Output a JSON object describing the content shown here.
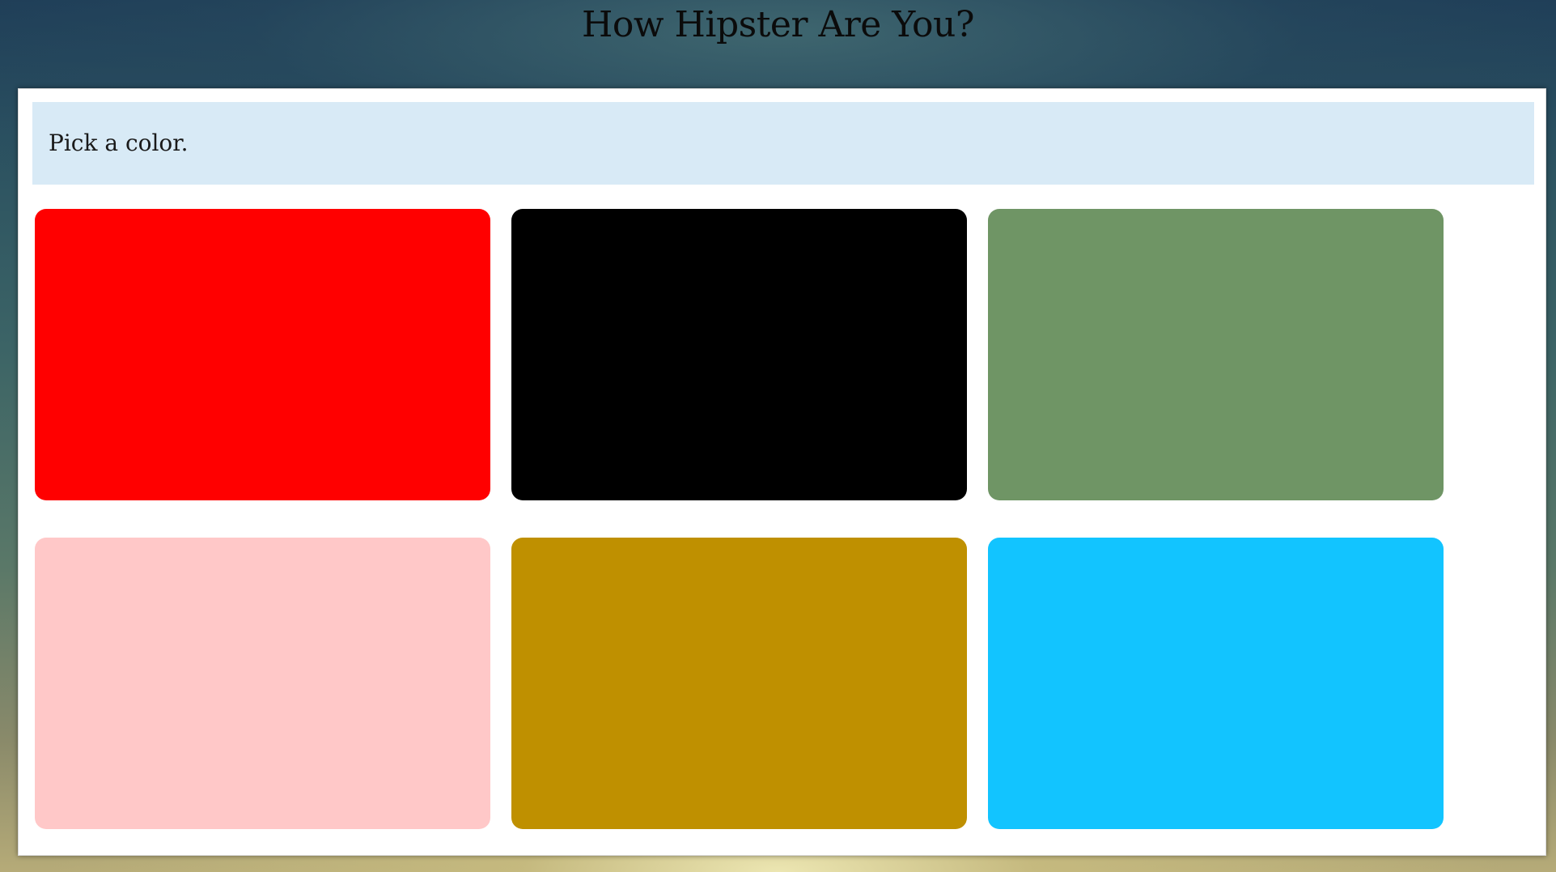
{
  "page": {
    "title": "How Hipster Are You?"
  },
  "question": {
    "text": "Pick a color."
  },
  "options": [
    {
      "name": "red",
      "color": "#ff0000"
    },
    {
      "name": "black",
      "color": "#000000"
    },
    {
      "name": "green",
      "color": "#6f9565"
    },
    {
      "name": "pink",
      "color": "#ffc8c8"
    },
    {
      "name": "mustard",
      "color": "#bf9000"
    },
    {
      "name": "sky-blue",
      "color": "#12c4ff"
    }
  ]
}
